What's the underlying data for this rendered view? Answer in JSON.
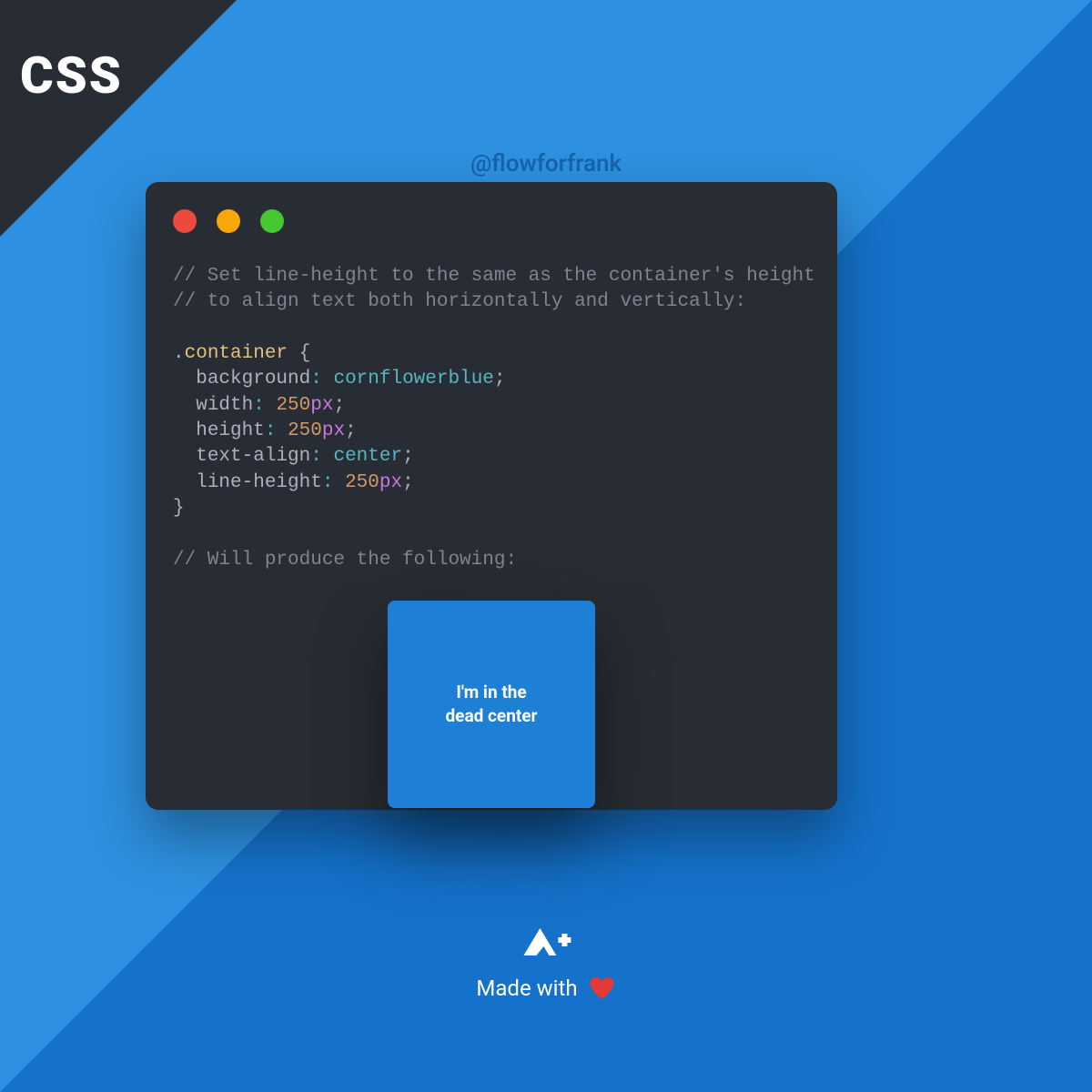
{
  "corner": {
    "label": "CSS"
  },
  "handle": "@flowforfrank",
  "code": {
    "comment1": "// Set line-height to the same as the container's height",
    "comment2": "// to align text both horizontally and vertically:",
    "selector_class": "container",
    "brace_open": "{",
    "brace_close": "}",
    "props": {
      "background": {
        "name": "background",
        "value_ident": "cornflowerblue"
      },
      "width": {
        "name": "width",
        "num": "250",
        "unit": "px"
      },
      "height": {
        "name": "height",
        "num": "250",
        "unit": "px"
      },
      "text_align": {
        "name": "text-align",
        "value_ident": "center"
      },
      "line_height": {
        "name": "line-height",
        "num": "250",
        "unit": "px"
      }
    },
    "comment3": "// Will produce the following:"
  },
  "demo": {
    "text": "I'm in the\ndead center",
    "bg": "#1e7fd6"
  },
  "footer": {
    "made_text": "Made with"
  }
}
